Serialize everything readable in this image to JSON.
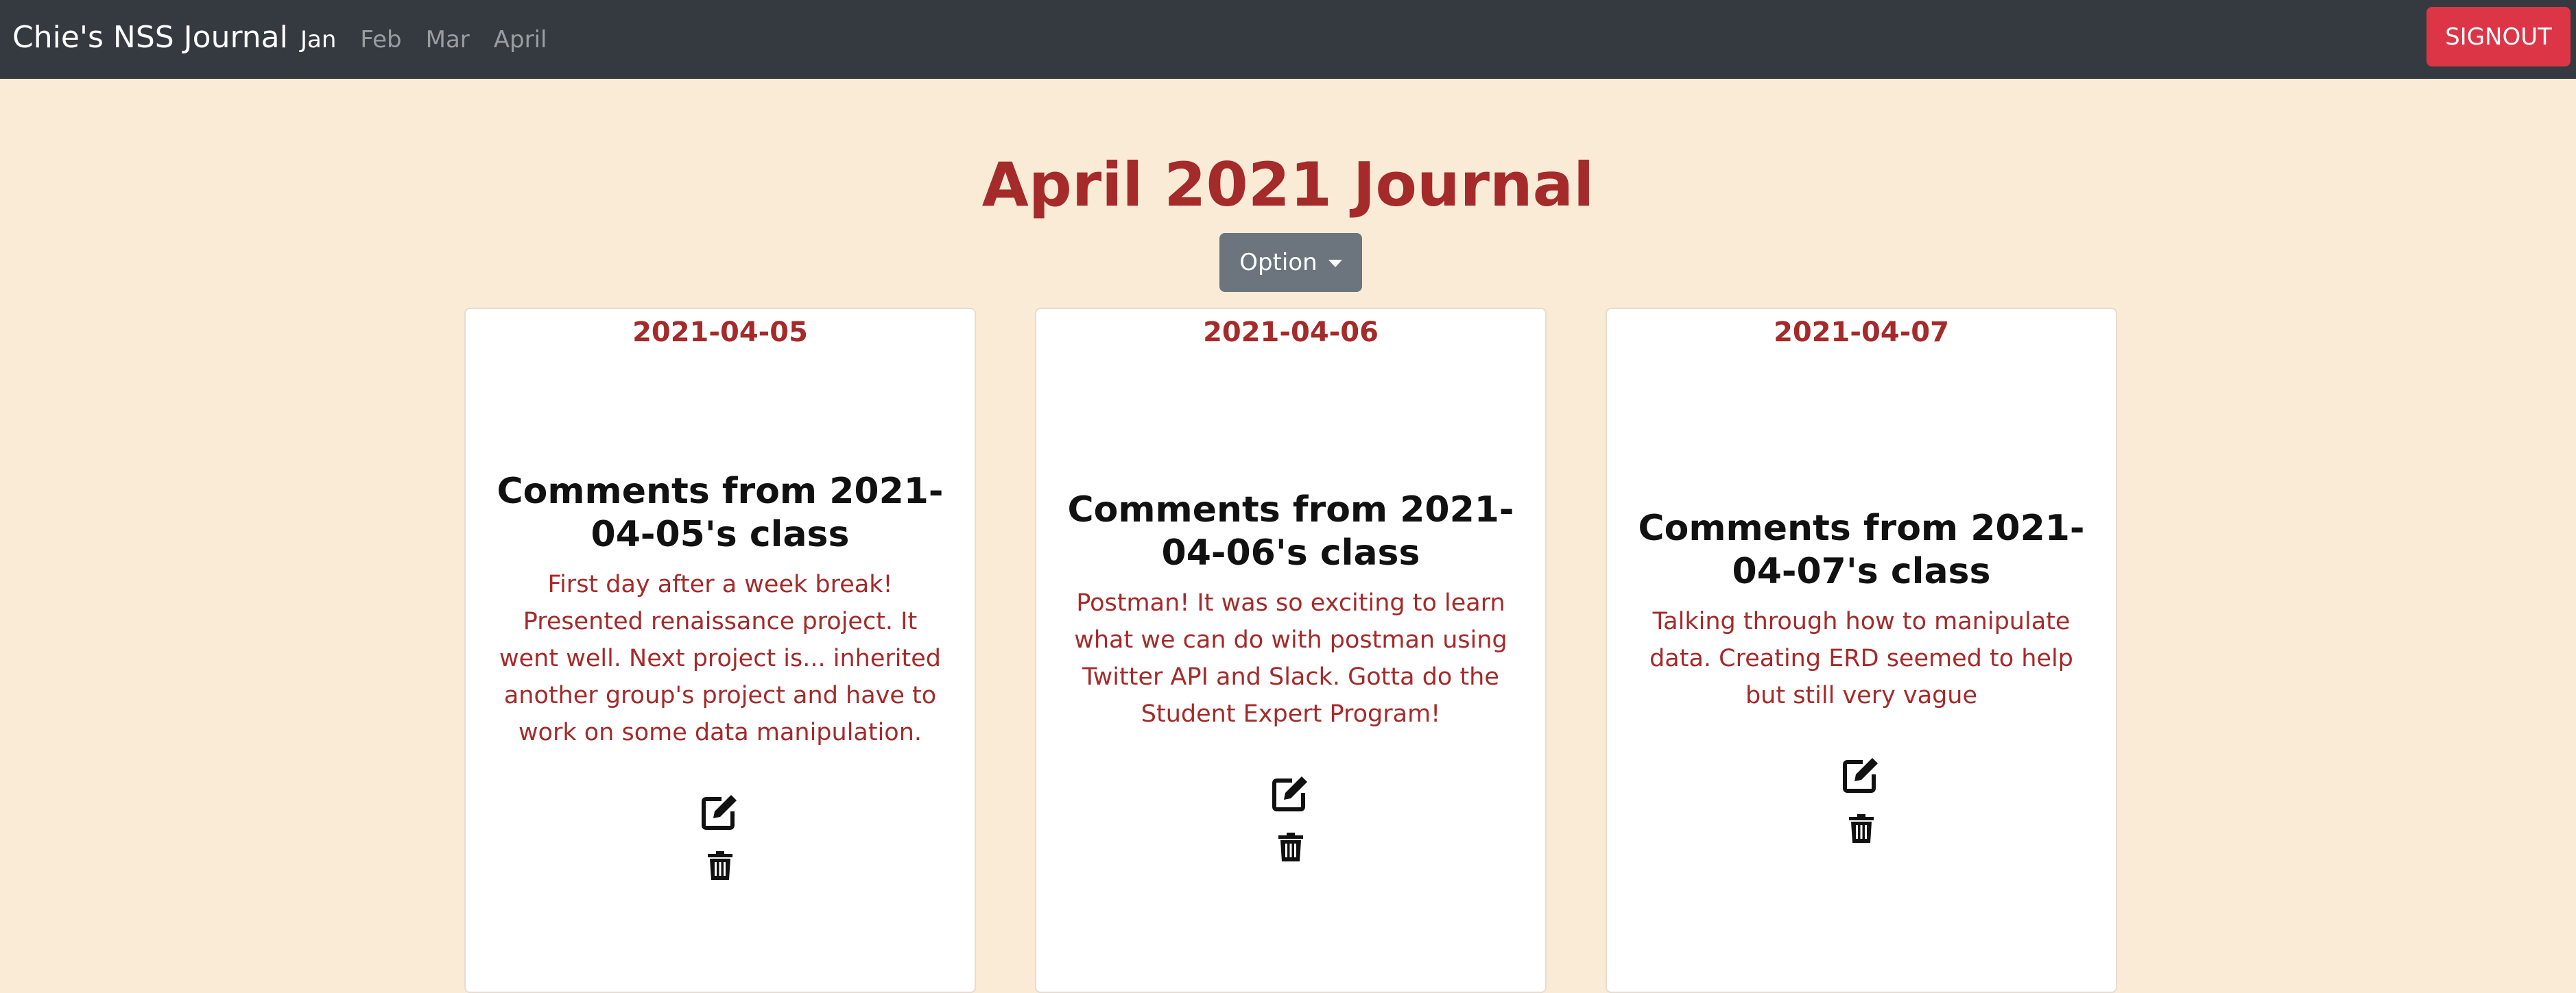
{
  "navbar": {
    "brand": "Chie's NSS Journal",
    "links": [
      "Jan",
      "Feb",
      "Mar",
      "April"
    ],
    "active_link": "Jan",
    "signout_label": "SIGNOUT"
  },
  "main": {
    "title": "April 2021 Journal",
    "option_label": "Option"
  },
  "cards": [
    {
      "date": "2021-04-05",
      "title": "Comments from 2021-04-05's class",
      "text": "First day after a week break! Presented renaissance project. It went well. Next project is... inherited another group's project and have to work on some data manipulation."
    },
    {
      "date": "2021-04-06",
      "title": "Comments from 2021-04-06's class",
      "text": "Postman! It was so exciting to learn what we can do with postman using Twitter API and Slack. Gotta do the Student Expert Program!"
    },
    {
      "date": "2021-04-07",
      "title": "Comments from 2021-04-07's class",
      "text": "Talking through how to manipulate data. Creating ERD seemed to help but still very vague"
    }
  ],
  "icons": {
    "edit": "edit-icon",
    "delete": "trash-icon"
  },
  "colors": {
    "background": "#faebd7",
    "navbar": "#343a40",
    "accent": "#a52a2a",
    "signout": "#dc3545",
    "option": "#6c757d"
  }
}
